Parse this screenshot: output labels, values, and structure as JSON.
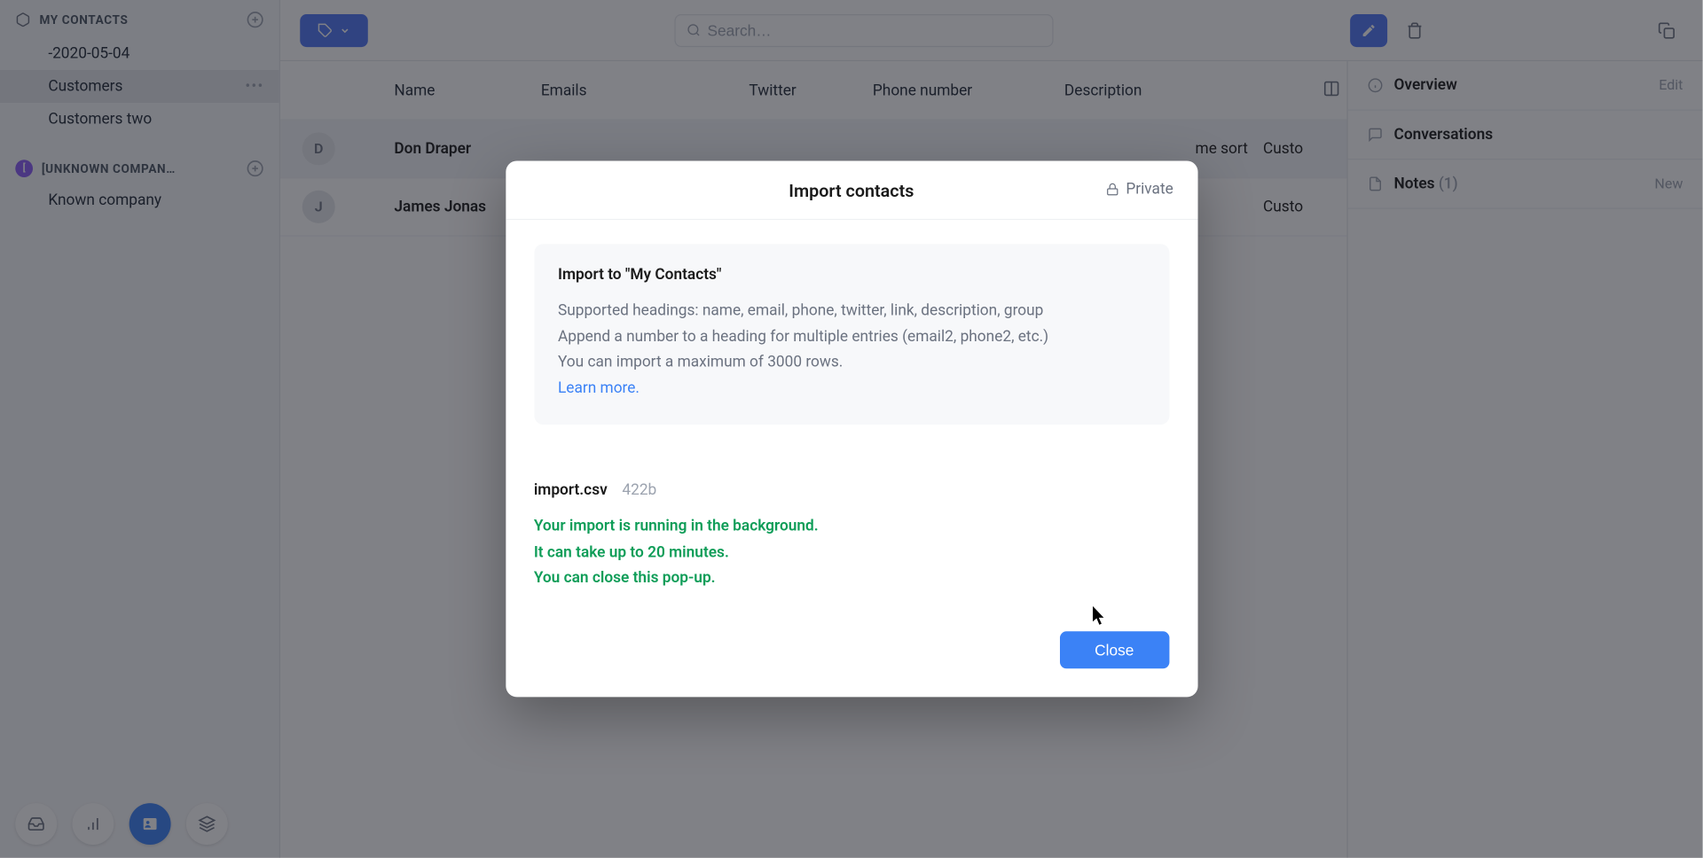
{
  "sidebar": {
    "section1_title": "MY CONTACTS",
    "items": [
      {
        "label": "-2020-05-04"
      },
      {
        "label": "Customers"
      },
      {
        "label": "Customers two"
      }
    ],
    "unknown_company": "[UNKNOWN COMPAN…",
    "known_company": "Known company"
  },
  "topbar": {
    "search_placeholder": "Search…"
  },
  "headers": {
    "name": "Name",
    "emails": "Emails",
    "twitter": "Twitter",
    "phone": "Phone number",
    "description": "Description"
  },
  "rows": [
    {
      "initial": "D",
      "name": "Don Draper",
      "emails": "",
      "twitter": "",
      "phone": "",
      "desc_visible": "me sort",
      "group": "Custo"
    },
    {
      "initial": "J",
      "name": "James Jonas",
      "emails": "",
      "twitter": "",
      "phone": "",
      "desc_visible": "",
      "group": "Custo"
    }
  ],
  "right_panel": {
    "overview": "Overview",
    "edit": "Edit",
    "conversations": "Conversations",
    "notes": "Notes",
    "notes_count": "(1)",
    "new": "New"
  },
  "modal": {
    "title": "Import contacts",
    "private": "Private",
    "info_title": "Import to \"My Contacts\"",
    "info_line1": "Supported headings: name, email, phone, twitter, link, description, group",
    "info_line2": "Append a number to a heading for multiple entries (email2, phone2, etc.)",
    "info_line3": "You can import a maximum of 3000 rows.",
    "learn_more": "Learn more.",
    "file_name": "import.csv",
    "file_size": "422b",
    "status_line1": "Your import is running in the background.",
    "status_line2": "It can take up to 20 minutes.",
    "status_line3": "You can close this pop-up.",
    "close": "Close"
  }
}
